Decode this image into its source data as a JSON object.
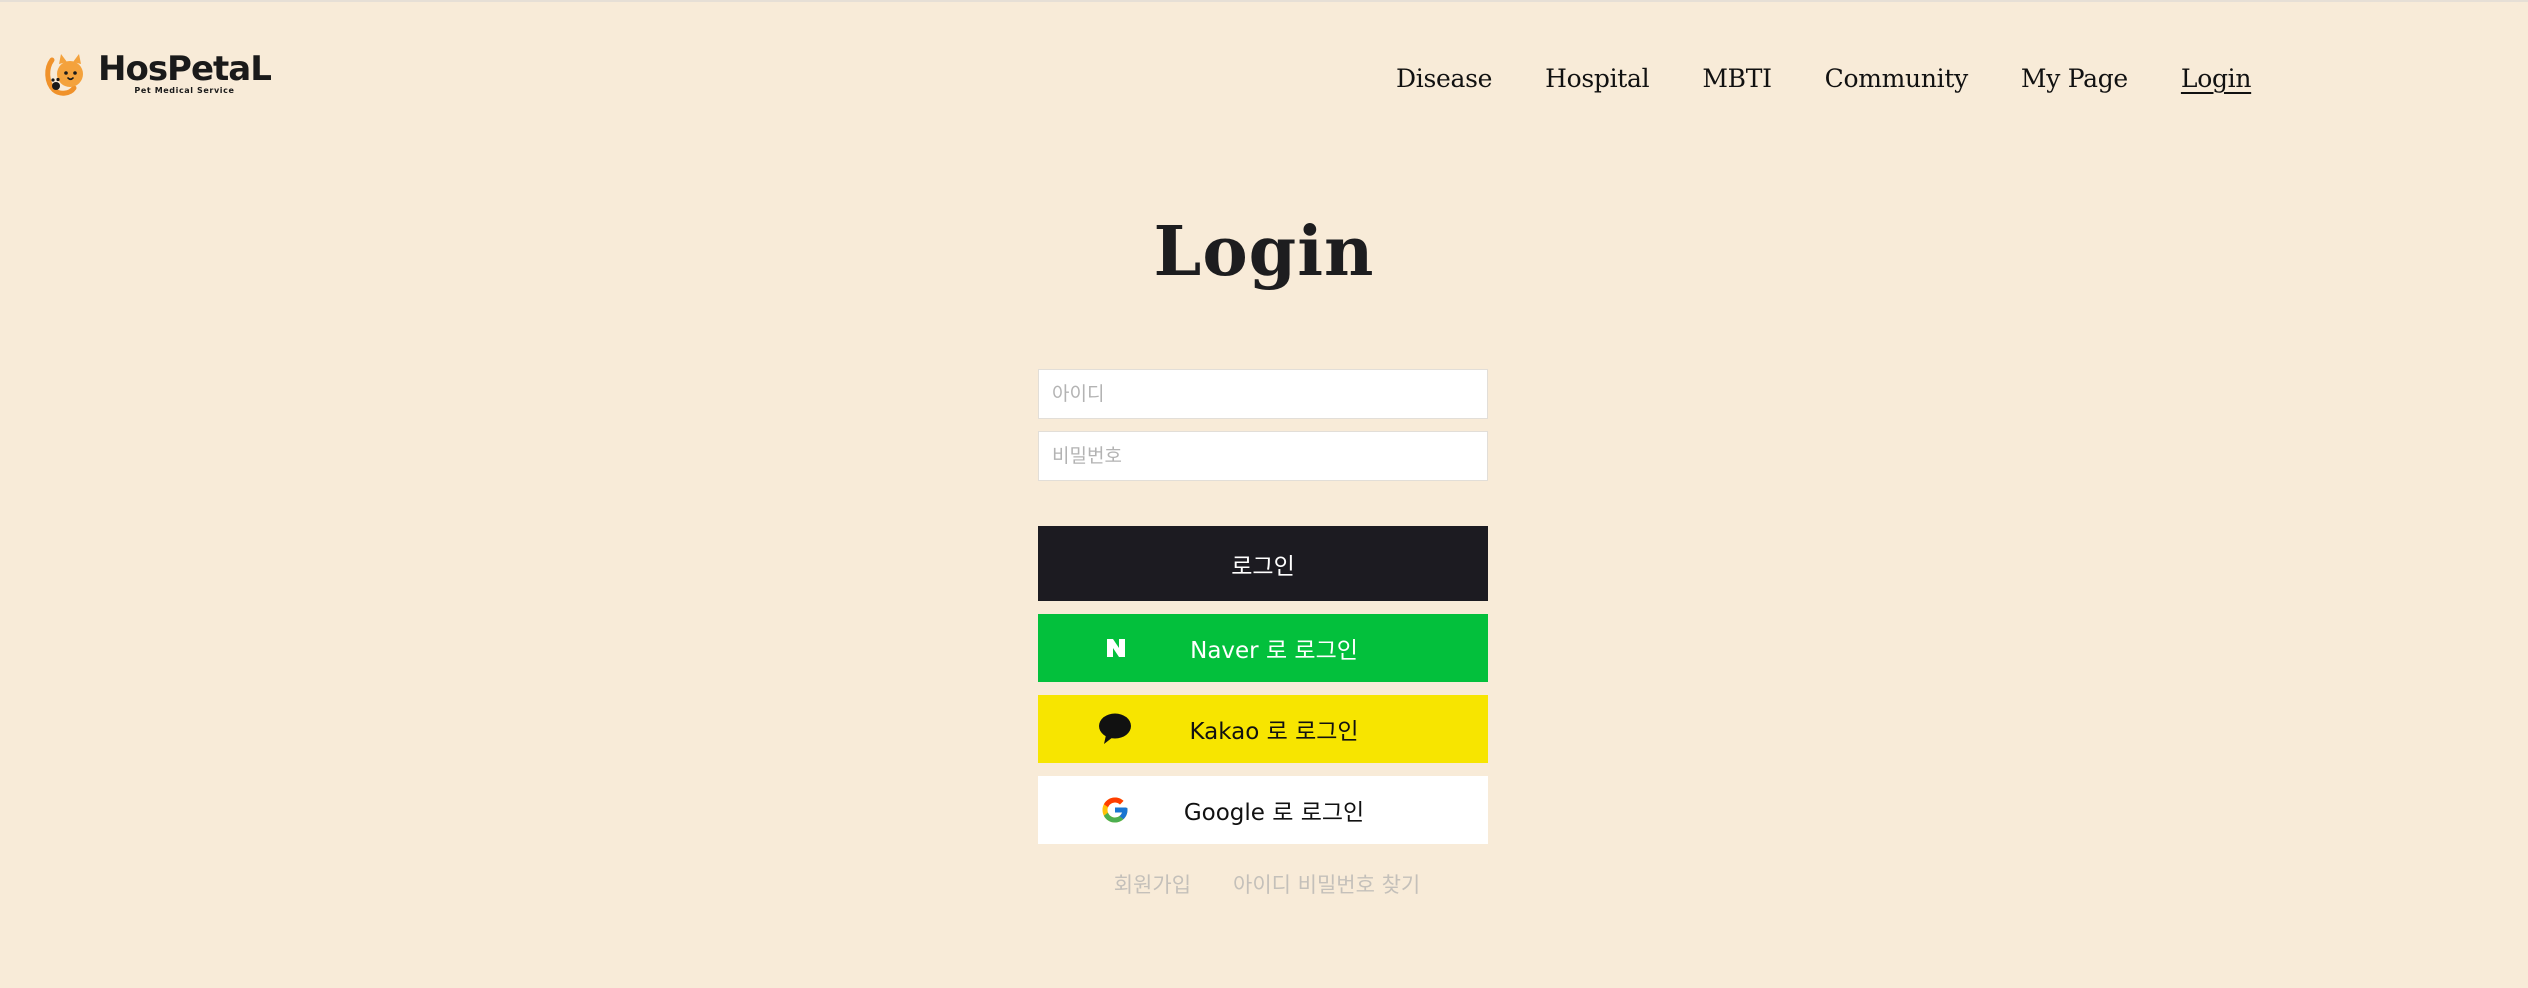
{
  "brand": {
    "name": "HosPetaL",
    "tagline": "Pet Medical Service",
    "accent": "#f0922b"
  },
  "nav": {
    "items": [
      {
        "label": "Disease"
      },
      {
        "label": "Hospital"
      },
      {
        "label": "MBTI"
      },
      {
        "label": "Community"
      },
      {
        "label": "My Page"
      },
      {
        "label": "Login",
        "active": true
      }
    ]
  },
  "page": {
    "title": "Login"
  },
  "form": {
    "id_placeholder": "아이디",
    "id_value": "",
    "password_placeholder": "비밀번호",
    "password_value": "",
    "login_label": "로그인"
  },
  "social": {
    "naver": {
      "label": "Naver 로 로그인",
      "color": "#03c03c",
      "icon": "naver-n-icon"
    },
    "kakao": {
      "label": "Kakao 로 로그인",
      "color": "#f7e500",
      "icon": "kakao-speech-bubble-icon"
    },
    "google": {
      "label": "Google 로 로그인",
      "color": "#ffffff",
      "icon": "google-g-icon"
    }
  },
  "links": {
    "signup": "회원가입",
    "find_account": "아이디 비밀번호 찾기"
  },
  "colors": {
    "background": "#f8ebd8",
    "login_button": "#1c1b21"
  }
}
